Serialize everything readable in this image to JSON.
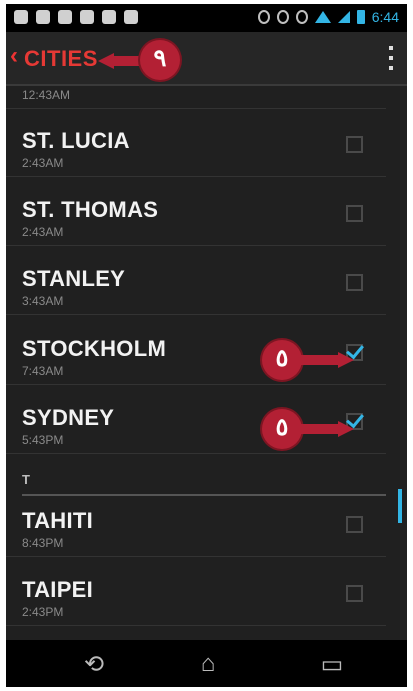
{
  "status_bar": {
    "time": "6:44"
  },
  "action_bar": {
    "back_glyph": "‹",
    "title": "CITIES"
  },
  "partial_row": {
    "time": "12:43AM"
  },
  "cities": [
    {
      "name": "ST. LUCIA",
      "time": "2:43AM",
      "checked": false
    },
    {
      "name": "ST. THOMAS",
      "time": "2:43AM",
      "checked": false
    },
    {
      "name": "STANLEY",
      "time": "3:43AM",
      "checked": false
    },
    {
      "name": "STOCKHOLM",
      "time": "7:43AM",
      "checked": true
    },
    {
      "name": "SYDNEY",
      "time": "5:43PM",
      "checked": true
    }
  ],
  "section_header": "T",
  "cities_t": [
    {
      "name": "TAHITI",
      "time": "8:43PM",
      "checked": false
    },
    {
      "name": "TAIPEI",
      "time": "2:43PM",
      "checked": false
    }
  ],
  "callouts": {
    "title_step": "٩",
    "check_step": "٥"
  },
  "nav": {
    "back": "⟲",
    "home": "⌂",
    "recents": "▭"
  },
  "colors": {
    "accent": "#33b5e5",
    "title_red": "#e53935",
    "callout": "#b32034"
  }
}
